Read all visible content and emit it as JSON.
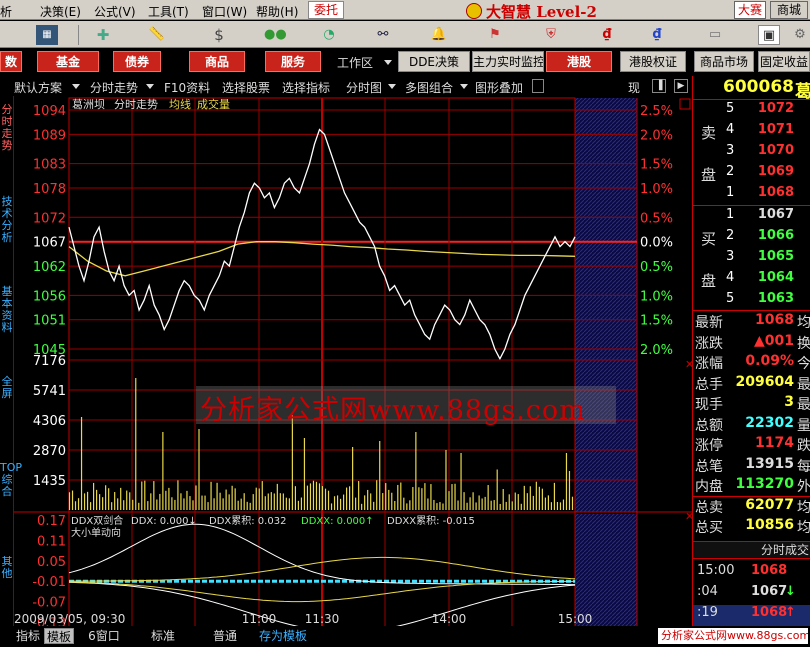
{
  "menu": {
    "items": [
      "析",
      "决策(E)",
      "公式(V)",
      "工具(T)",
      "窗口(W)",
      "帮助(H)"
    ],
    "trust_button": "委托",
    "brand": "大智慧 Level-2",
    "dasai": "大赛",
    "mall": "商城"
  },
  "quickbar": {
    "buttons": [
      "数",
      "基金",
      "债券",
      "商品",
      "服务"
    ],
    "workspace": "工作区",
    "buttons2": [
      "DDE决策",
      "主力实时监控",
      "港股",
      "港股权证",
      "商品市场",
      "固定收益"
    ]
  },
  "subbar": {
    "items": [
      "默认方案",
      "分时走势",
      "F10资料",
      "选择股票",
      "选择指标",
      "分时图",
      "多图组合",
      "图形叠加"
    ],
    "right_label": "现"
  },
  "left_tabs": [
    "分时走势",
    "技术分析",
    "基本资料",
    "全屏",
    "TOP综合",
    "其他"
  ],
  "chart": {
    "header": {
      "stock_name": "葛洲坝",
      "mode": "分时走势",
      "ma_label": "均线",
      "vol_label": "成交量"
    },
    "price_labels": [
      "1094",
      "1089",
      "1083",
      "1078",
      "1072",
      "1067",
      "1062",
      "1056",
      "1051",
      "1045"
    ],
    "pct_labels": [
      "2.5%",
      "2.0%",
      "1.5%",
      "1.0%",
      "0.5%",
      "0.0%",
      "0.5%",
      "1.0%",
      "1.5%",
      "2.0%"
    ],
    "vol_labels": [
      "7176",
      "5741",
      "4306",
      "2870",
      "1435"
    ],
    "ddx_header": {
      "name": "DDX双剑合",
      "ddx": "DDX: 0.000↓",
      "ddx_sum": "DDX累积: 0.032",
      "ddxx": "DDXX: 0.000↑",
      "ddxx_sum": "DDXX累积: -0.015"
    },
    "ddx_sub": "大小单动向",
    "ddx_labels": [
      "0.17",
      "0.11",
      "0.05",
      "-0.01",
      "-0.07",
      "-0.13"
    ],
    "date_label": "2009/03/05, 09:30",
    "time_labels": [
      "11:00",
      "11:30",
      "14:00",
      "15:00"
    ]
  },
  "chart_data": {
    "type": "line",
    "title": "葛洲坝 分时走势",
    "x_range": [
      "09:30",
      "15:00"
    ],
    "ylim": [
      10.45,
      10.94
    ],
    "prev_close": 10.67,
    "series": [
      {
        "name": "分时走势",
        "color": "#ffffff",
        "values": [
          10.7,
          10.66,
          10.62,
          10.59,
          10.63,
          10.68,
          10.7,
          10.65,
          10.61,
          10.59,
          10.62,
          10.58,
          10.56,
          10.57,
          10.53,
          10.55,
          10.58,
          10.54,
          10.52,
          10.49,
          10.51,
          10.54,
          10.57,
          10.59,
          10.58,
          10.56,
          10.55,
          10.53,
          10.56,
          10.58,
          10.6,
          10.63,
          10.62,
          10.66,
          10.7,
          10.73,
          10.77,
          10.79,
          10.78,
          10.76,
          10.77,
          10.74,
          10.76,
          10.79,
          10.8,
          10.78,
          10.77,
          10.8,
          10.83,
          10.87,
          10.9,
          10.89,
          10.86,
          10.83,
          10.8,
          10.77,
          10.75,
          10.73,
          10.71,
          10.7,
          10.68,
          10.66,
          10.62,
          10.6,
          10.57,
          10.58,
          10.56,
          10.54,
          10.55,
          10.52,
          10.5,
          10.48,
          10.47,
          10.5,
          10.52,
          10.54,
          10.53,
          10.51,
          10.5,
          10.52,
          10.55,
          10.53,
          10.51,
          10.5,
          10.48,
          10.45,
          10.43,
          10.45,
          10.48,
          10.5,
          10.53,
          10.56,
          10.58,
          10.6,
          10.62,
          10.64,
          10.66,
          10.68,
          10.66,
          10.67,
          10.66,
          10.68
        ]
      },
      {
        "name": "均线",
        "color": "#e8d84a",
        "values": [
          10.66,
          10.63,
          10.61,
          10.6,
          10.61,
          10.62,
          10.63,
          10.64,
          10.65,
          10.665,
          10.67,
          10.67,
          10.668,
          10.665,
          10.663,
          10.66,
          10.658,
          10.655,
          10.653,
          10.65,
          10.648,
          10.646,
          10.644,
          10.643,
          10.642,
          10.642,
          10.641,
          10.64
        ]
      }
    ],
    "volume": {
      "name": "成交量",
      "ylim": [
        0,
        7176
      ],
      "max_bar": 7176
    }
  },
  "orderbook": {
    "code": "600068",
    "name_fragment": "葛",
    "sell_label": [
      "卖",
      "盘"
    ],
    "buy_label": [
      "买",
      "盘"
    ],
    "sell": [
      {
        "lvl": "5",
        "price": "1072"
      },
      {
        "lvl": "4",
        "price": "1071"
      },
      {
        "lvl": "3",
        "price": "1070"
      },
      {
        "lvl": "2",
        "price": "1069"
      },
      {
        "lvl": "1",
        "price": "1068"
      }
    ],
    "buy": [
      {
        "lvl": "1",
        "price": "1067"
      },
      {
        "lvl": "2",
        "price": "1066"
      },
      {
        "lvl": "3",
        "price": "1065"
      },
      {
        "lvl": "4",
        "price": "1064"
      },
      {
        "lvl": "5",
        "price": "1063"
      }
    ]
  },
  "stats": [
    {
      "label": "最新",
      "value": "1068",
      "color": "#ff3030",
      "extra": "均"
    },
    {
      "label": "涨跌",
      "value": "▲001",
      "color": "#ff3030",
      "extra": "换"
    },
    {
      "label": "涨幅",
      "value": "0.09%",
      "color": "#ff3030",
      "extra": "今"
    },
    {
      "label": "总手",
      "value": "209604",
      "color": "#ffff40",
      "extra": "最"
    },
    {
      "label": "现手",
      "value": "3",
      "color": "#ffff40",
      "extra": "最"
    },
    {
      "label": "总额",
      "value": "22302",
      "color": "#40ffff",
      "extra": "量"
    },
    {
      "label": "涨停",
      "value": "1174",
      "color": "#ff3030",
      "extra": "跌"
    },
    {
      "label": "总笔",
      "value": "13915",
      "color": "#dddddd",
      "extra": "每"
    },
    {
      "label": "内盘",
      "value": "113270",
      "color": "#40ff40",
      "extra": "外"
    },
    {
      "label": "总卖",
      "value": "62077",
      "color": "#ffff40",
      "extra": "均"
    },
    {
      "label": "总买",
      "value": "10856",
      "color": "#ffff40",
      "extra": "均"
    }
  ],
  "ticks": {
    "header": "分时成交",
    "rows": [
      {
        "time": "15:00",
        "price": "1068",
        "arrow": ""
      },
      {
        "time": ":04",
        "price": "1067",
        "arrow": "↓"
      },
      {
        "time": ":19",
        "price": "1068",
        "arrow": "↑"
      }
    ]
  },
  "bottom": {
    "tabs": [
      "指标",
      "模板",
      "6窗口",
      "标准",
      "普通",
      "存为模板"
    ]
  },
  "watermark": "分析家公式网www.88gs.com",
  "watermark2": "分析家公式网www.88gs.com",
  "colors": {
    "up": "#ff3030",
    "down": "#40ff40",
    "grid": "#a00000",
    "price_line": "#ffffff",
    "avg_line": "#e8d84a"
  }
}
